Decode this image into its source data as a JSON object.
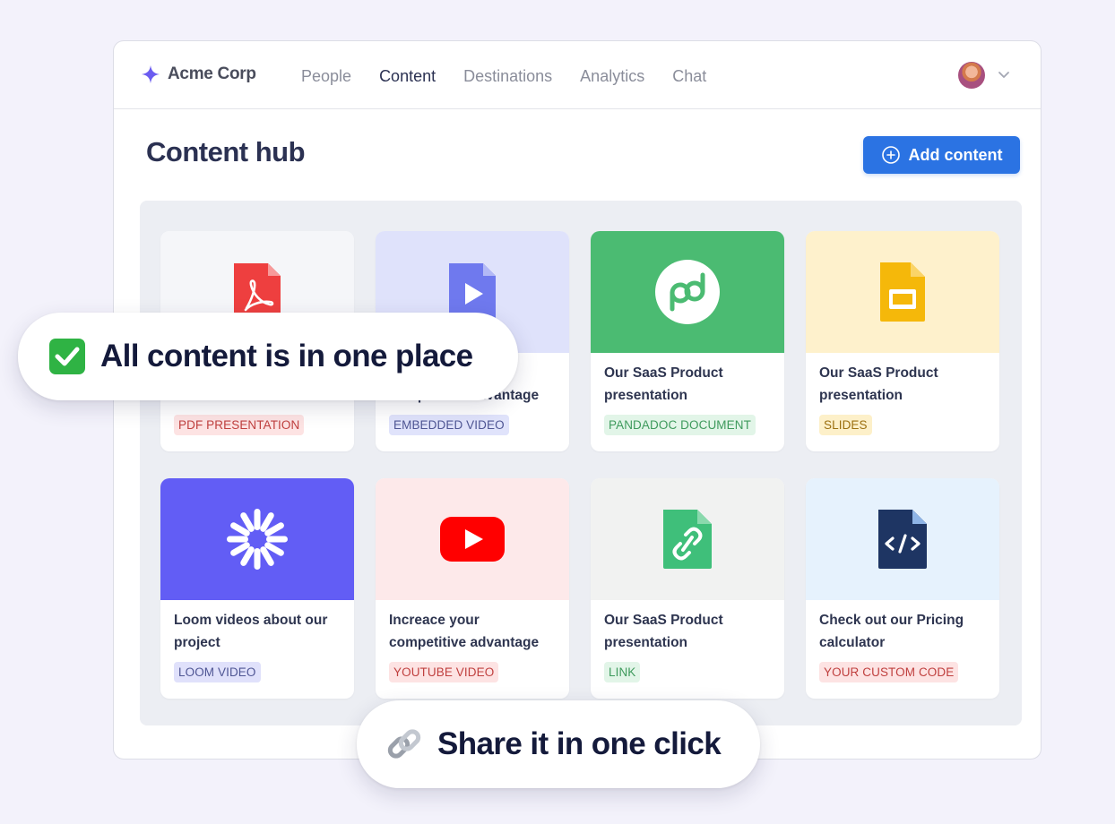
{
  "brand": {
    "name": "Acme Corp"
  },
  "nav": {
    "items": [
      {
        "label": "People",
        "active": false
      },
      {
        "label": "Content",
        "active": true
      },
      {
        "label": "Destinations",
        "active": false
      },
      {
        "label": "Analytics",
        "active": false
      },
      {
        "label": "Chat",
        "active": false
      }
    ]
  },
  "page": {
    "title": "Content hub",
    "add_button_label": "Add content"
  },
  "cards": [
    {
      "title": "",
      "tag": "PDF PRESENTATION",
      "icon": "pdf-icon"
    },
    {
      "title": "Increace your competitive advantage",
      "tag": "EMBEDDED VIDEO",
      "icon": "video-file-icon"
    },
    {
      "title": "Our SaaS Product presentation",
      "tag": "PANDADOC DOCUMENT",
      "icon": "pandadoc-icon"
    },
    {
      "title": "Our SaaS Product presentation",
      "tag": "SLIDES",
      "icon": "google-slides-icon"
    },
    {
      "title": "Loom videos about our project",
      "tag": "LOOM VIDEO",
      "icon": "loom-icon"
    },
    {
      "title": "Increace your competitive advantage",
      "tag": "YOUTUBE VIDEO",
      "icon": "youtube-icon"
    },
    {
      "title": "Our SaaS Product presentation",
      "tag": "LINK",
      "icon": "link-file-icon"
    },
    {
      "title": "Check out our Pricing calculator",
      "tag": "YOUR CUSTOM CODE",
      "icon": "code-file-icon"
    }
  ],
  "callouts": {
    "first": "All content is in one place",
    "second": "Share it in one click"
  },
  "colors": {
    "accent": "#2b73e3",
    "pandadoc_green": "#4bbb72",
    "loom_purple": "#625df5",
    "youtube_red": "#ff0000"
  }
}
